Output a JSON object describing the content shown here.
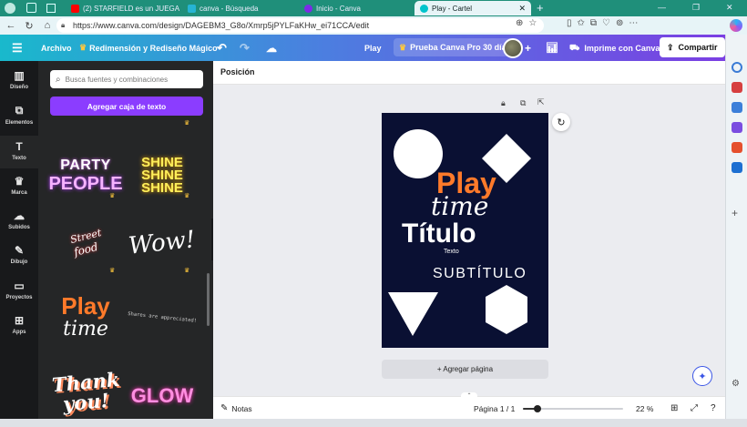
{
  "browser": {
    "tabs": [
      {
        "label": "(2) STARFIELD es un JUEGAZ",
        "favicon_color": "#ff0000",
        "active": false
      },
      {
        "label": "canva - Búsqueda",
        "favicon_color": "#26b4d4",
        "active": false
      },
      {
        "label": "Inicio - Canva",
        "favicon_color": "#7d2ae8",
        "active": false
      },
      {
        "label": "Play - Cartel",
        "favicon_color": "#00c4cc",
        "active": true
      }
    ],
    "new_tab_glyph": "+",
    "window_controls": [
      "—",
      "❐",
      "✕"
    ],
    "url": "https://www.canva.com/design/DAGEBM3_G8o/Xmrp5jPYLFaKHw_ei71CCA/edit"
  },
  "header": {
    "menu_icon": "hamburger-icon",
    "archivo": "Archivo",
    "magic": "Redimensión y Rediseño Mágico",
    "play": "Play",
    "trial": "Prueba Canva Pro 30 días",
    "print": "Imprime con Canva",
    "share": "Compartir"
  },
  "rail": [
    {
      "label": "Diseño",
      "icon": "▥"
    },
    {
      "label": "Elementos",
      "icon": "⧉"
    },
    {
      "label": "Texto",
      "icon": "T"
    },
    {
      "label": "Marca",
      "icon": "♛"
    },
    {
      "label": "Subidos",
      "icon": "☁"
    },
    {
      "label": "Dibujo",
      "icon": "✎"
    },
    {
      "label": "Proyectos",
      "icon": "▭"
    },
    {
      "label": "Apps",
      "icon": "⊞"
    }
  ],
  "panel": {
    "search_placeholder": "Busca fuentes y combinaciones",
    "add_text_button": "Agregar caja de texto",
    "cards": {
      "party": "PARTY",
      "people": "PEOPLE",
      "shine": "SHINE",
      "street": "Street",
      "food": "food",
      "wow": "Wow!",
      "play": "Play",
      "time": "time",
      "shares": "Shares are appreciated!",
      "thank": "Thank",
      "you": "you!",
      "glow": "GLOW"
    }
  },
  "editor": {
    "toolbar_label": "Posición",
    "design": {
      "play": "Play",
      "time": "time",
      "title": "Título",
      "text": "Texto",
      "subtitle": "SUBTÍTULO"
    },
    "add_page": "+ Agregar página"
  },
  "footer": {
    "notes": "Notas",
    "page_indicator": "Página 1 / 1",
    "zoom": "22 %",
    "zoom_fraction": 0.22
  },
  "colors": {
    "accent_purple": "#8b3dff",
    "design_bg": "#0a1033",
    "play_orange": "#ff7a2a"
  }
}
